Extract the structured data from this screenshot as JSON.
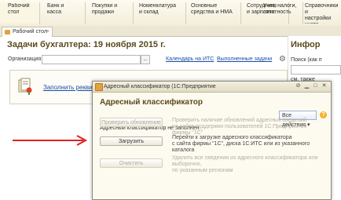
{
  "sections": [
    {
      "label_1": "Рабочий",
      "label_2": "стол",
      "active": true
    },
    {
      "label_1": "Банк и",
      "label_2": "касса"
    },
    {
      "label_1": "Покупки и",
      "label_2": "продажи"
    },
    {
      "label_1": "Номенклатура",
      "label_2": "и склад"
    },
    {
      "label_1": "Основные",
      "label_2": "средства и НМА"
    },
    {
      "label_1": "Сотрудники",
      "label_2": "и зарплата"
    },
    {
      "label_1": "Учет, налоги,",
      "label_2": "отчетность"
    },
    {
      "label_1": "Справочники и",
      "label_2": "настройки учета"
    }
  ],
  "tab": {
    "label": "Рабочий стол",
    "close": "×"
  },
  "desktop": {
    "title": "Задачи бухгалтера: 19 ноября 2015 г.",
    "org_label": "Организация:",
    "org_btn": "...",
    "calendar_link": "Календарь на ИТС",
    "done_tasks_link": "Выполненные задачи",
    "task_link": "Заполнить рекви"
  },
  "informer": {
    "title": "Инфор",
    "search_label": "Поиск (как п",
    "more_label": "см. также"
  },
  "dialog": {
    "title": "Адресный классификатор  (1С:Предприятие",
    "heading": "Адресный классификатор",
    "all_actions": "Все действия ▾",
    "help": "?",
    "message": "Адресный классификатор не заполнен.",
    "buttons": [
      {
        "label": "Проверить обновление",
        "enabled": false,
        "desc_1": "Проверить наличие обновлений адресных сведений",
        "desc_2": "на сайте поддержки пользователей 1С:Предприятия фирмы \"1С\""
      },
      {
        "label": "Загрузить",
        "enabled": true,
        "desc_1": "Перейти к загрузке адресного классификатора",
        "desc_2": "с сайта фирмы \"1С\", диска 1С:ИТС или из указанного каталога"
      },
      {
        "label": "Очистить",
        "enabled": false,
        "desc_1": "Удалить все сведения из адресного классификатора или выборочно,",
        "desc_2": "по указанным регионам"
      }
    ]
  },
  "colors": {
    "accent_title": "#5a4a1c",
    "link": "#1a4ea5",
    "arrow": "#e02020"
  }
}
